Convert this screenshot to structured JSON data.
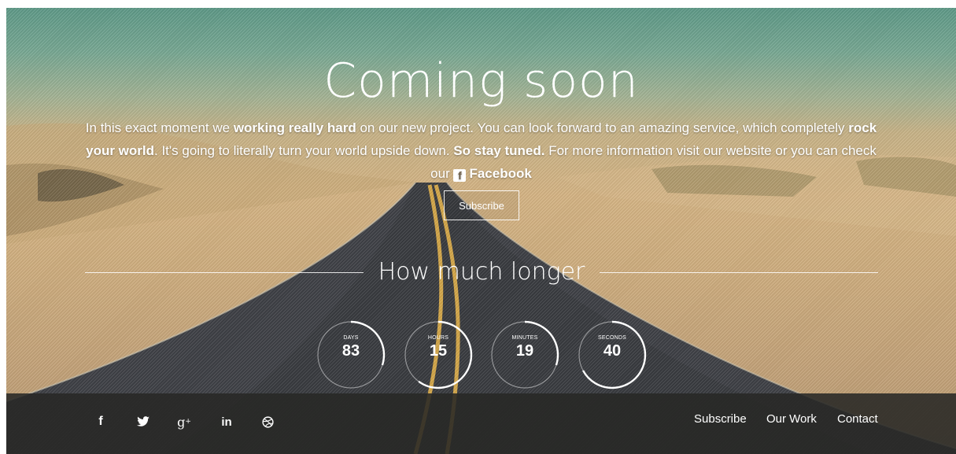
{
  "hero": {
    "title": "Coming soon",
    "intro_parts": [
      {
        "text": "In this exact moment we ",
        "bold": false
      },
      {
        "text": "working really hard",
        "bold": true
      },
      {
        "text": " on our new project. You can look forward to an amazing service, which completely ",
        "bold": false
      },
      {
        "text": "rock your world",
        "bold": true
      },
      {
        "text": ". It's going to literally turn your world upside down. ",
        "bold": false
      },
      {
        "text": "So stay tuned.",
        "bold": true
      },
      {
        "text": " For more information visit our website or you can check our ",
        "bold": false
      }
    ],
    "facebook_label": "Facebook",
    "subscribe_label": "Subscribe"
  },
  "countdown": {
    "heading": "How much longer",
    "items": [
      {
        "label": "DAYS",
        "value": "83",
        "progress": 0.3
      },
      {
        "label": "HOURS",
        "value": "15",
        "progress": 0.6
      },
      {
        "label": "MINUTES",
        "value": "19",
        "progress": 0.3
      },
      {
        "label": "SECONDS",
        "value": "40",
        "progress": 0.67
      }
    ]
  },
  "footer": {
    "social_icons": [
      "facebook-icon",
      "twitter-icon",
      "google-plus-icon",
      "linkedin-icon",
      "dribbble-icon"
    ],
    "links": [
      "Subscribe",
      "Our Work",
      "Contact"
    ]
  }
}
